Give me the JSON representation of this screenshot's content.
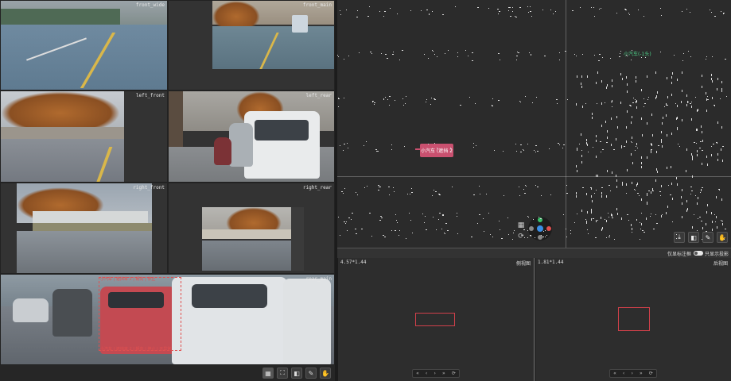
{
  "cameras": [
    {
      "id": "front_wide",
      "label": "front_wide"
    },
    {
      "id": "front_main",
      "label": "front_main"
    },
    {
      "id": "left_front",
      "label": "left_front"
    },
    {
      "id": "left_rear",
      "label": "left_rear"
    },
    {
      "id": "right_front",
      "label": "right_front"
    },
    {
      "id": "right_rear",
      "label": "right_rear"
    },
    {
      "id": "rear_main",
      "label": "rear_main"
    }
  ],
  "pointcloud": {
    "label_text": "小汽车 (遮挡 2",
    "green_tag": "小汽车(-1头)"
  },
  "toggles": {
    "first": "仅显标注框",
    "second": "只显示投影"
  },
  "ortho_views": [
    {
      "dims": "4.57*1.44",
      "name": "侧视图"
    },
    {
      "dims": "1.81*1.44",
      "name": "后视图"
    }
  ],
  "rear_annotations": {
    "top": "小汽车 | 遮挡率 2 | 朝向 | 停止",
    "bottom": "小汽车 | 遮挡率 2 | 朝向 | 停止 | 无异常"
  },
  "icons": {
    "grid": "grid-icon",
    "refresh": "refresh-icon",
    "download": "download-icon",
    "crop": "crop-icon",
    "cube": "cube-icon",
    "pen": "pen-icon",
    "hand": "hand-icon"
  }
}
